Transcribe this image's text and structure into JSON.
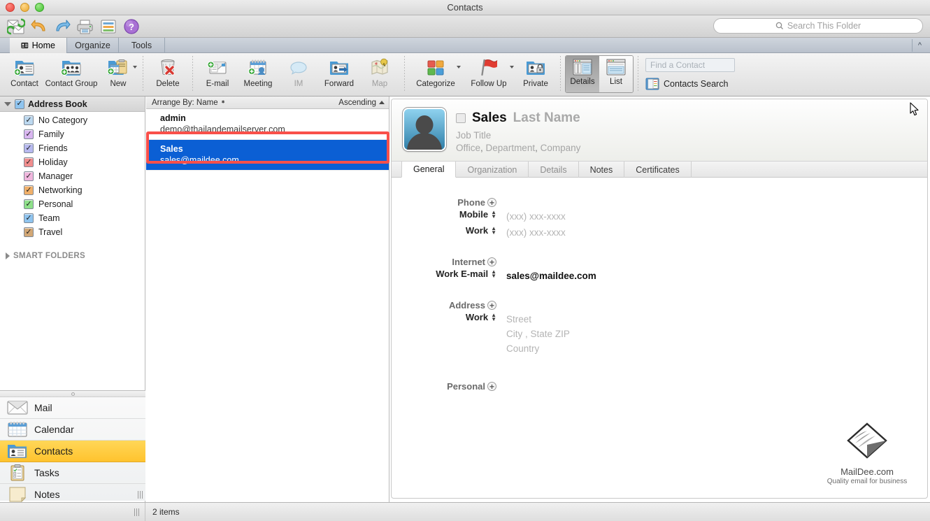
{
  "window": {
    "title": "Contacts"
  },
  "quick_toolbar": {
    "buttons": [
      {
        "name": "send-receive-icon",
        "label": "Send/Receive"
      },
      {
        "name": "undo-icon",
        "label": "Undo"
      },
      {
        "name": "redo-icon",
        "label": "Redo"
      },
      {
        "name": "print-icon",
        "label": "Print"
      },
      {
        "name": "view-icon",
        "label": "View"
      },
      {
        "name": "help-icon",
        "label": "Help"
      }
    ],
    "search_placeholder": "Search This Folder",
    "search_icon": "search-icon"
  },
  "ribbon": {
    "tabs": [
      {
        "label": "Home",
        "active": true,
        "icon": "contacts-card-icon"
      },
      {
        "label": "Organize",
        "active": false
      },
      {
        "label": "Tools",
        "active": false
      }
    ],
    "collapse_icon": "chevron-up-icon",
    "groups": [
      {
        "items": [
          {
            "label": "Contact",
            "icon": "new-contact-icon",
            "dim": false,
            "caret": false
          },
          {
            "label": "Contact Group",
            "icon": "new-contact-group-icon",
            "dim": false,
            "caret": false,
            "wide": true
          },
          {
            "label": "New",
            "icon": "new-item-icon",
            "dim": false,
            "caret": true
          }
        ]
      },
      {
        "items": [
          {
            "label": "Delete",
            "icon": "delete-trash-icon",
            "dim": false,
            "caret": false
          }
        ]
      },
      {
        "items": [
          {
            "label": "E-mail",
            "icon": "email-icon",
            "dim": false,
            "caret": false
          },
          {
            "label": "Meeting",
            "icon": "meeting-icon",
            "dim": false,
            "caret": false
          },
          {
            "label": "IM",
            "icon": "im-bubble-icon",
            "dim": true,
            "caret": false
          },
          {
            "label": "Forward",
            "icon": "forward-icon",
            "dim": false,
            "caret": false
          },
          {
            "label": "Map",
            "icon": "map-icon",
            "dim": true,
            "caret": false
          }
        ]
      },
      {
        "items": [
          {
            "label": "Categorize",
            "icon": "categorize-icon",
            "dim": false,
            "caret": true,
            "wide": true
          },
          {
            "label": "Follow Up",
            "icon": "follow-up-flag-icon",
            "dim": false,
            "caret": true,
            "wide": true
          },
          {
            "label": "Private",
            "icon": "private-lock-icon",
            "dim": false,
            "caret": false
          }
        ]
      }
    ],
    "view_toggle": [
      {
        "label": "Details",
        "active": true,
        "icon": "details-view-icon"
      },
      {
        "label": "List",
        "active": false,
        "icon": "list-view-icon"
      }
    ],
    "find_contact_placeholder": "Find a Contact",
    "contacts_search_label": "Contacts Search",
    "contacts_search_icon": "address-book-icon"
  },
  "sidebar": {
    "address_book": {
      "label": "Address Book",
      "checked": true,
      "expanded": true
    },
    "categories": [
      {
        "label": "No Category",
        "color": "#bcd8ef"
      },
      {
        "label": "Family",
        "color": "#d9b6f0"
      },
      {
        "label": "Friends",
        "color": "#b7b9ef"
      },
      {
        "label": "Holiday",
        "color": "#f08d8d"
      },
      {
        "label": "Manager",
        "color": "#f0b6dd"
      },
      {
        "label": "Networking",
        "color": "#f0b06a"
      },
      {
        "label": "Personal",
        "color": "#8fe08a"
      },
      {
        "label": "Team",
        "color": "#8fc4ef"
      },
      {
        "label": "Travel",
        "color": "#d2a775"
      }
    ],
    "smart_folders": {
      "label": "SMART FOLDERS",
      "expanded": false
    },
    "nav": [
      {
        "label": "Mail",
        "icon": "mail-envelope-icon",
        "selected": false
      },
      {
        "label": "Calendar",
        "icon": "calendar-icon",
        "selected": false
      },
      {
        "label": "Contacts",
        "icon": "contacts-card-icon",
        "selected": true
      },
      {
        "label": "Tasks",
        "icon": "tasks-clipboard-icon",
        "selected": false
      },
      {
        "label": "Notes",
        "icon": "notes-page-icon",
        "selected": false
      }
    ]
  },
  "list_pane": {
    "arrange_label": "Arrange By: Name",
    "sort_label": "Ascending",
    "contacts": [
      {
        "name": "admin",
        "email": "demo@thailandemailserver.com",
        "selected": false
      },
      {
        "name": "Sales",
        "email": "sales@maildee.com",
        "selected": true
      }
    ],
    "annotation_color": "#f9504a"
  },
  "detail": {
    "first_name": "Sales",
    "last_name": "Last Name",
    "job_title": "Job Title",
    "office": "Office",
    "department": "Department",
    "company": "Company",
    "avatar_icon": "contact-avatar-icon",
    "tabs": [
      {
        "label": "General",
        "active": true
      },
      {
        "label": "Organization",
        "active": false
      },
      {
        "label": "Details",
        "active": false
      },
      {
        "label": "Notes",
        "active": false
      },
      {
        "label": "Certificates",
        "active": false
      }
    ],
    "sections": {
      "phone": {
        "heading": "Phone",
        "rows": [
          {
            "label": "Mobile",
            "value": "(xxx) xxx-xxxx",
            "filled": false
          },
          {
            "label": "Work",
            "value": "(xxx) xxx-xxxx",
            "filled": false
          }
        ]
      },
      "internet": {
        "heading": "Internet",
        "rows": [
          {
            "label": "Work E-mail",
            "value": "sales@maildee.com",
            "filled": true
          }
        ]
      },
      "address": {
        "heading": "Address",
        "rows": [
          {
            "label": "Work",
            "line1": "Street",
            "line2a": "City",
            "line2sep": ",",
            "line2b": "State ZIP",
            "line3": "Country"
          }
        ]
      },
      "personal": {
        "heading": "Personal"
      }
    },
    "logo": {
      "name": "MailDee.com",
      "tagline": "Quality email for business",
      "icon": "maildee-logo-icon"
    }
  },
  "status_bar": {
    "items_label": "2 items"
  }
}
